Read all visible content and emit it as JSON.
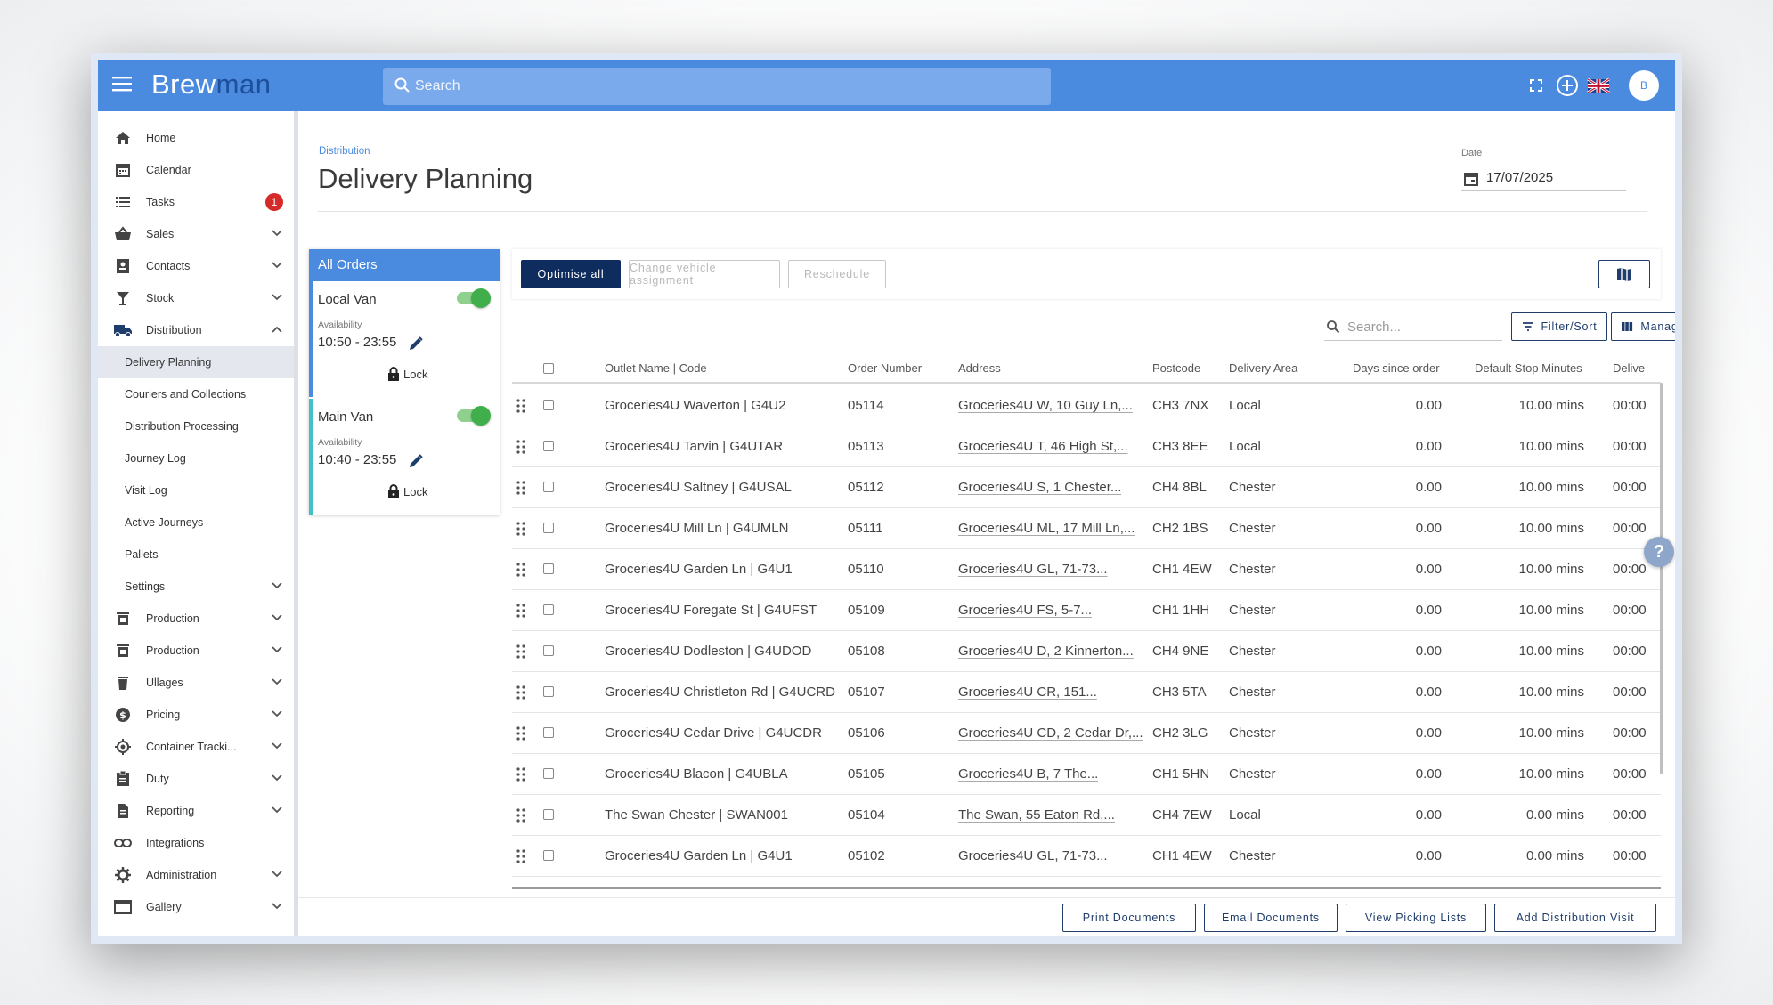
{
  "app": {
    "logo_part1": "Brew",
    "logo_part2": "man",
    "avatar_initial": "B"
  },
  "search": {
    "placeholder": "Search"
  },
  "sidebar": {
    "items": [
      {
        "label": "Home",
        "icon": "home-icon"
      },
      {
        "label": "Calendar",
        "icon": "calendar-icon"
      },
      {
        "label": "Tasks",
        "icon": "list-icon",
        "badge": "1"
      },
      {
        "label": "Sales",
        "icon": "basket-icon"
      },
      {
        "label": "Contacts",
        "icon": "contacts-icon"
      },
      {
        "label": "Stock",
        "icon": "glass-icon"
      },
      {
        "label": "Distribution",
        "icon": "truck-icon"
      },
      {
        "label": "Delivery Planning"
      },
      {
        "label": "Couriers and Collections"
      },
      {
        "label": "Distribution Processing"
      },
      {
        "label": "Journey Log"
      },
      {
        "label": "Visit Log"
      },
      {
        "label": "Active Journeys"
      },
      {
        "label": "Pallets"
      },
      {
        "label": "Settings"
      },
      {
        "label": "Production",
        "icon": "vessel-icon"
      },
      {
        "label": "Production",
        "icon": "vessel-icon"
      },
      {
        "label": "Ullages",
        "icon": "bin-icon"
      },
      {
        "label": "Pricing",
        "icon": "dollar-icon"
      },
      {
        "label": "Container Tracki...",
        "icon": "target-icon"
      },
      {
        "label": "Duty",
        "icon": "clipboard-icon"
      },
      {
        "label": "Reporting",
        "icon": "report-icon"
      },
      {
        "label": "Integrations",
        "icon": "link-icon"
      },
      {
        "label": "Administration",
        "icon": "gear-icon"
      },
      {
        "label": "Gallery",
        "icon": "gallery-icon"
      }
    ]
  },
  "page": {
    "breadcrumb": "Distribution",
    "title": "Delivery Planning",
    "date_label": "Date",
    "date_value": "17/07/2025"
  },
  "vehicles": {
    "header": "All Orders",
    "items": [
      {
        "name": "Local Van",
        "availability_label": "Availability",
        "time": "10:50 - 23:55",
        "lock_label": "Lock",
        "enabled": true
      },
      {
        "name": "Main Van",
        "availability_label": "Availability",
        "time": "10:40 - 23:55",
        "lock_label": "Lock",
        "enabled": true
      }
    ]
  },
  "actions": {
    "optimise": "Optimise all",
    "change_vehicle": "Change vehicle assignment",
    "reschedule": "Reschedule"
  },
  "table_tools": {
    "search_placeholder": "Search...",
    "filter_sort": "Filter/Sort",
    "manage_columns": "Manage Columns"
  },
  "table": {
    "headers": [
      "Outlet Name | Code",
      "Order Number",
      "Address",
      "Postcode",
      "Delivery Area",
      "Days since order",
      "Default Stop Minutes",
      "Delive"
    ],
    "rows": [
      [
        "Groceries4U Waverton | G4U2",
        "05114",
        "Groceries4U W, 10 Guy Ln,...",
        "CH3 7NX",
        "Local",
        "0.00",
        "10.00 mins",
        "00:00"
      ],
      [
        "Groceries4U Tarvin | G4UTAR",
        "05113",
        "Groceries4U T, 46 High St,...",
        "CH3 8EE",
        "Local",
        "0.00",
        "10.00 mins",
        "00:00"
      ],
      [
        "Groceries4U Saltney | G4USAL",
        "05112",
        "Groceries4U S, 1 Chester...",
        "CH4 8BL",
        "Chester",
        "0.00",
        "10.00 mins",
        "00:00"
      ],
      [
        "Groceries4U Mill Ln | G4UMLN",
        "05111",
        "Groceries4U ML, 17 Mill Ln,...",
        "CH2 1BS",
        "Chester",
        "0.00",
        "10.00 mins",
        "00:00"
      ],
      [
        "Groceries4U Garden Ln | G4U1",
        "05110",
        "Groceries4U GL, 71-73...",
        "CH1 4EW",
        "Chester",
        "0.00",
        "10.00 mins",
        "00:00"
      ],
      [
        "Groceries4U Foregate St | G4UFST",
        "05109",
        "Groceries4U FS, 5-7...",
        "CH1 1HH",
        "Chester",
        "0.00",
        "10.00 mins",
        "00:00"
      ],
      [
        "Groceries4U Dodleston | G4UDOD",
        "05108",
        "Groceries4U D, 2 Kinnerton...",
        "CH4 9NE",
        "Chester",
        "0.00",
        "10.00 mins",
        "00:00"
      ],
      [
        "Groceries4U Christleton Rd | G4UCRD",
        "05107",
        "Groceries4U CR, 151...",
        "CH3 5TA",
        "Chester",
        "0.00",
        "10.00 mins",
        "00:00"
      ],
      [
        "Groceries4U Cedar Drive | G4UCDR",
        "05106",
        "Groceries4U CD, 2 Cedar Dr,...",
        "CH2 3LG",
        "Chester",
        "0.00",
        "10.00 mins",
        "00:00"
      ],
      [
        "Groceries4U Blacon | G4UBLA",
        "05105",
        "Groceries4U B, 7 The...",
        "CH1 5HN",
        "Chester",
        "0.00",
        "10.00 mins",
        "00:00"
      ],
      [
        "The Swan Chester | SWAN001",
        "05104",
        "The Swan, 55 Eaton Rd,...",
        "CH4 7EW",
        "Local",
        "0.00",
        "0.00 mins",
        "00:00"
      ],
      [
        "Groceries4U Garden Ln | G4U1",
        "05102",
        "Groceries4U GL, 71-73...",
        "CH1 4EW",
        "Chester",
        "0.00",
        "0.00 mins",
        "00:00"
      ]
    ]
  },
  "footer": {
    "print": "Print Documents",
    "email": "Email Documents",
    "picking": "View Picking Lists",
    "add_visit": "Add Distribution Visit"
  },
  "colors": {
    "topbar": "#4a8be0",
    "primary_button": "#0e2d5e",
    "toggle_on": "#3fae4b",
    "badge": "#d42a2a"
  }
}
